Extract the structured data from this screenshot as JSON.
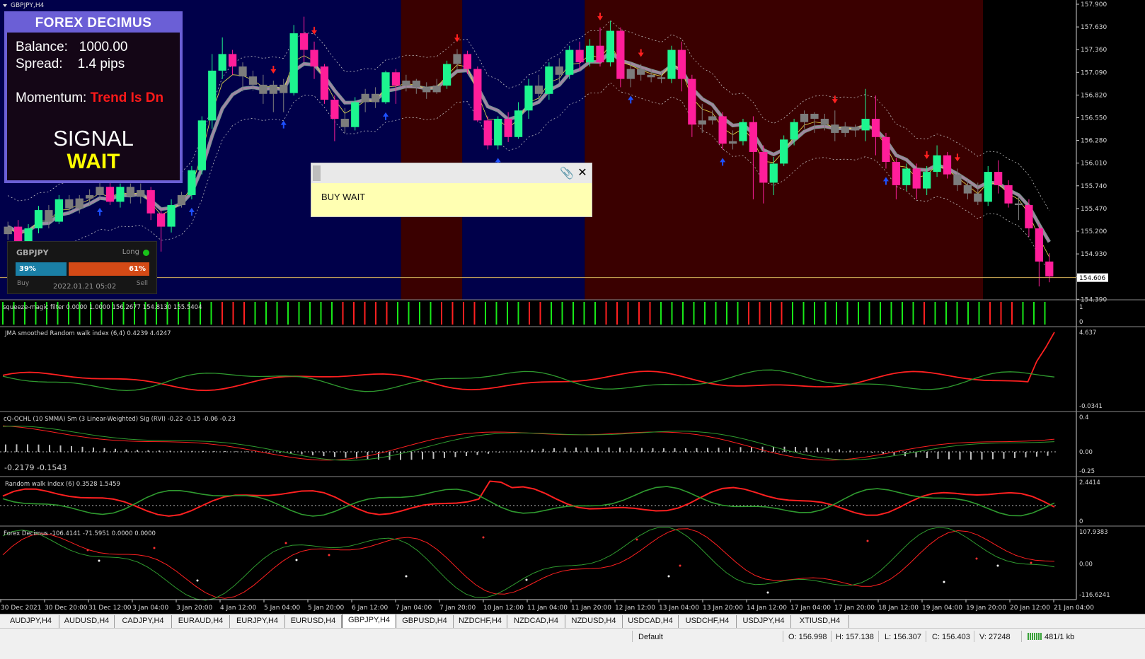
{
  "window": {
    "title": "GBPJPY,H4"
  },
  "panel": {
    "title": "FOREX DECIMUS",
    "balance_label": "Balance:",
    "balance_value": "1000.00",
    "spread_label": "Spread:",
    "spread_value": "1.4 pips",
    "momentum_label": "Momentum:",
    "momentum_value": "Trend Is Dn",
    "signal_label": "SIGNAL",
    "signal_value": "WAIT",
    "colors": {
      "border": "#6b5fd6",
      "wait": "#ffff00",
      "trend": "#ff1a1a"
    }
  },
  "sentiment": {
    "symbol": "GBPJPY",
    "long_label": "Long",
    "buy_pct": "39%",
    "sell_pct": "61%",
    "buy_label": "Buy",
    "sell_label": "Sell",
    "date": "2022.01.21 05:02",
    "buy_fraction": 0.39
  },
  "alert": {
    "message": "BUY WAIT"
  },
  "indicators": {
    "squeeze": "squeeze-magic filter 0.0000 1.0000 156.2677 154.8130 155.5404",
    "jma": "JMA smoothed Random walk index (6,4) 0.4239 4.4247",
    "cq": "cQ-OCHL (10 SMMA)  Sm (3 Linear-Weighted)  Sig (RVI)   -0.22 -0.15 -0.06 -0.23",
    "cq_values": "-0.2179    -0.1543",
    "rwi": "Random walk index (6) 0.3528 1.5459",
    "fd": "Forex Decimus -106.4141 -71.5951 0.0000 0.0000"
  },
  "price_axis": {
    "labels": [
      "157.900",
      "157.630",
      "157.360",
      "157.090",
      "156.820",
      "156.550",
      "156.280",
      "156.010",
      "155.740",
      "155.470",
      "155.200",
      "154.930",
      "154.660",
      "154.390"
    ],
    "current": "154.606"
  },
  "indicator_axes": {
    "squeeze": [
      "1",
      "0"
    ],
    "jma": [
      "4.637",
      "-0.0341"
    ],
    "cq": [
      "0.4",
      "0.00",
      "-0.25"
    ],
    "rwi": [
      "2.4414",
      "0"
    ],
    "fd": [
      "107.9383",
      "0.00",
      "-116.6241"
    ]
  },
  "time_axis": [
    "30 Dec 2021",
    "30 Dec 20:00",
    "31 Dec 12:00",
    "3 Jan 04:00",
    "3 Jan 20:00",
    "4 Jan 12:00",
    "5 Jan 04:00",
    "5 Jan 20:00",
    "6 Jan 12:00",
    "7 Jan 04:00",
    "7 Jan 20:00",
    "10 Jan 12:00",
    "11 Jan 04:00",
    "11 Jan 20:00",
    "12 Jan 12:00",
    "13 Jan 04:00",
    "13 Jan 20:00",
    "14 Jan 12:00",
    "17 Jan 04:00",
    "17 Jan 20:00",
    "18 Jan 12:00",
    "19 Jan 04:00",
    "19 Jan 20:00",
    "20 Jan 12:00",
    "21 Jan 04:00"
  ],
  "tabs": [
    "AUDJPY,H4",
    "AUDUSD,H4",
    "CADJPY,H4",
    "EURAUD,H4",
    "EURJPY,H4",
    "EURUSD,H4",
    "GBPJPY,H4",
    "GBPUSD,H4",
    "NZDCHF,H4",
    "NZDCAD,H4",
    "NZDUSD,H4",
    "USDCAD,H4",
    "USDCHF,H4",
    "USDJPY,H4",
    "XTIUSD,H4"
  ],
  "active_tab": "GBPJPY,H4",
  "status": {
    "profile": "Default",
    "open": "O: 156.998",
    "high": "H: 157.138",
    "low": "L: 156.307",
    "close": "C: 156.403",
    "volume": "V: 27248",
    "traffic": "481/1 kb"
  },
  "chart_data": {
    "type": "candlestick",
    "symbol": "GBPJPY",
    "timeframe": "H4",
    "ylim": [
      154.39,
      157.9
    ],
    "current_price": 154.606,
    "trend_zones": [
      {
        "from": 0,
        "to": 39,
        "trend": "up",
        "color": "#00004a"
      },
      {
        "from": 39,
        "to": 45,
        "trend": "down",
        "color": "#3a0000"
      },
      {
        "from": 45,
        "to": 57,
        "trend": "up",
        "color": "#00004a"
      },
      {
        "from": 57,
        "to": 96,
        "trend": "down",
        "color": "#3a0000"
      }
    ],
    "candles": [
      [
        155.13,
        155.22,
        155.06,
        155.28
      ],
      [
        155.22,
        155.03,
        154.95,
        155.3
      ],
      [
        155.03,
        155.2,
        155.0,
        155.25
      ],
      [
        155.2,
        155.42,
        155.14,
        155.47
      ],
      [
        155.42,
        155.28,
        155.2,
        155.48
      ],
      [
        155.28,
        155.55,
        155.25,
        155.6
      ],
      [
        155.55,
        155.44,
        155.38,
        155.6
      ],
      [
        155.44,
        155.56,
        155.38,
        155.6
      ],
      [
        155.56,
        155.6,
        155.48,
        155.67
      ],
      [
        155.6,
        155.7,
        155.55,
        155.8
      ],
      [
        155.7,
        155.52,
        155.48,
        155.78
      ],
      [
        155.52,
        155.7,
        155.45,
        155.74
      ],
      [
        155.7,
        155.58,
        155.5,
        155.74
      ],
      [
        155.58,
        155.66,
        155.5,
        155.74
      ],
      [
        155.66,
        155.38,
        155.3,
        155.7
      ],
      [
        155.38,
        155.22,
        154.92,
        155.42
      ],
      [
        155.22,
        155.48,
        155.15,
        155.55
      ],
      [
        155.48,
        155.6,
        155.45,
        155.64
      ],
      [
        155.6,
        155.9,
        155.55,
        155.95
      ],
      [
        155.9,
        156.5,
        155.85,
        156.55
      ],
      [
        156.5,
        157.1,
        156.4,
        157.3
      ],
      [
        157.1,
        157.3,
        157.0,
        157.5
      ],
      [
        157.3,
        157.15,
        157.05,
        157.35
      ],
      [
        157.15,
        157.03,
        156.85,
        157.2
      ],
      [
        157.03,
        156.93,
        156.86,
        157.1
      ],
      [
        156.93,
        156.82,
        156.7,
        157.05
      ],
      [
        156.82,
        156.93,
        156.6,
        156.98
      ],
      [
        156.93,
        156.83,
        156.6,
        157.0
      ],
      [
        156.83,
        157.55,
        156.8,
        157.65
      ],
      [
        157.55,
        157.35,
        157.2,
        157.75
      ],
      [
        157.35,
        157.15,
        157.0,
        157.45
      ],
      [
        157.15,
        156.75,
        156.7,
        157.18
      ],
      [
        156.75,
        156.52,
        156.25,
        156.8
      ],
      [
        156.52,
        156.42,
        156.35,
        156.65
      ],
      [
        156.42,
        156.72,
        156.38,
        156.78
      ],
      [
        156.72,
        156.82,
        156.6,
        156.88
      ],
      [
        156.82,
        156.72,
        156.65,
        156.9
      ],
      [
        156.72,
        157.08,
        156.7,
        157.1
      ],
      [
        157.08,
        156.92,
        156.7,
        157.12
      ],
      [
        156.92,
        156.98,
        156.85,
        157.05
      ],
      [
        156.98,
        156.9,
        156.82,
        157.0
      ],
      [
        156.9,
        156.84,
        156.76,
        156.96
      ],
      [
        156.84,
        156.92,
        156.82,
        157.0
      ],
      [
        156.92,
        157.18,
        156.88,
        157.22
      ],
      [
        157.18,
        157.3,
        157.12,
        157.36
      ],
      [
        157.3,
        157.12,
        157.06,
        157.34
      ],
      [
        157.12,
        156.5,
        156.48,
        157.15
      ],
      [
        156.5,
        156.2,
        156.15,
        156.55
      ],
      [
        156.2,
        156.52,
        156.15,
        156.55
      ],
      [
        156.52,
        156.3,
        156.24,
        156.6
      ],
      [
        156.3,
        156.62,
        156.28,
        156.72
      ],
      [
        156.62,
        156.92,
        156.52,
        157.0
      ],
      [
        156.92,
        156.82,
        156.75,
        157.05
      ],
      [
        156.82,
        157.15,
        156.75,
        157.2
      ],
      [
        157.15,
        157.05,
        156.95,
        157.25
      ],
      [
        157.05,
        157.35,
        157.0,
        157.4
      ],
      [
        157.35,
        157.2,
        157.1,
        157.45
      ],
      [
        157.2,
        157.4,
        157.15,
        157.48
      ],
      [
        157.4,
        157.2,
        157.15,
        157.62
      ],
      [
        157.2,
        157.58,
        157.15,
        157.7
      ],
      [
        157.58,
        157.0,
        156.9,
        157.62
      ],
      [
        157.0,
        157.12,
        156.9,
        157.2
      ],
      [
        157.12,
        157.05,
        156.98,
        157.18
      ],
      [
        157.05,
        157.02,
        156.96,
        157.12
      ],
      [
        157.02,
        157.0,
        156.95,
        157.1
      ],
      [
        157.0,
        157.35,
        156.95,
        157.4
      ],
      [
        157.35,
        157.0,
        156.85,
        157.45
      ],
      [
        157.0,
        156.45,
        156.3,
        157.05
      ],
      [
        156.45,
        156.5,
        156.35,
        156.7
      ],
      [
        156.5,
        156.55,
        156.45,
        156.62
      ],
      [
        156.55,
        156.22,
        156.15,
        156.6
      ],
      [
        156.22,
        156.25,
        156.15,
        156.38
      ],
      [
        156.25,
        156.48,
        156.2,
        156.52
      ],
      [
        156.48,
        156.12,
        155.55,
        156.55
      ],
      [
        156.12,
        155.75,
        155.5,
        156.2
      ],
      [
        155.75,
        155.98,
        155.6,
        156.06
      ],
      [
        155.98,
        156.27,
        155.95,
        156.32
      ],
      [
        156.27,
        156.48,
        156.2,
        156.52
      ],
      [
        156.48,
        156.58,
        156.4,
        156.62
      ],
      [
        156.58,
        156.52,
        156.35,
        156.6
      ],
      [
        156.52,
        156.45,
        156.38,
        156.58
      ],
      [
        156.45,
        156.35,
        156.25,
        156.62
      ],
      [
        156.35,
        156.42,
        156.3,
        156.48
      ],
      [
        156.42,
        156.38,
        156.3,
        156.45
      ],
      [
        156.38,
        156.52,
        156.25,
        156.88
      ],
      [
        156.52,
        156.3,
        156.08,
        156.8
      ],
      [
        156.3,
        156.0,
        155.92,
        156.35
      ],
      [
        156.0,
        155.72,
        155.55,
        156.05
      ],
      [
        155.72,
        155.92,
        155.65,
        155.98
      ],
      [
        155.92,
        155.68,
        155.55,
        155.98
      ],
      [
        155.68,
        155.88,
        155.6,
        155.95
      ],
      [
        155.88,
        156.08,
        155.82,
        156.2
      ],
      [
        156.08,
        155.85,
        155.8,
        156.12
      ],
      [
        155.85,
        155.72,
        155.65,
        155.92
      ],
      [
        155.72,
        155.62,
        155.55,
        155.78
      ],
      [
        155.62,
        155.52,
        155.48,
        155.75
      ],
      [
        155.52,
        155.88,
        155.47,
        155.95
      ],
      [
        155.88,
        155.72,
        155.62,
        156.02
      ],
      [
        155.72,
        155.5,
        155.45,
        155.78
      ],
      [
        155.5,
        155.48,
        155.3,
        155.58
      ],
      [
        155.48,
        155.2,
        155.1,
        155.55
      ],
      [
        155.2,
        154.8,
        154.5,
        155.25
      ],
      [
        154.8,
        154.62,
        154.55,
        154.9
      ]
    ]
  }
}
